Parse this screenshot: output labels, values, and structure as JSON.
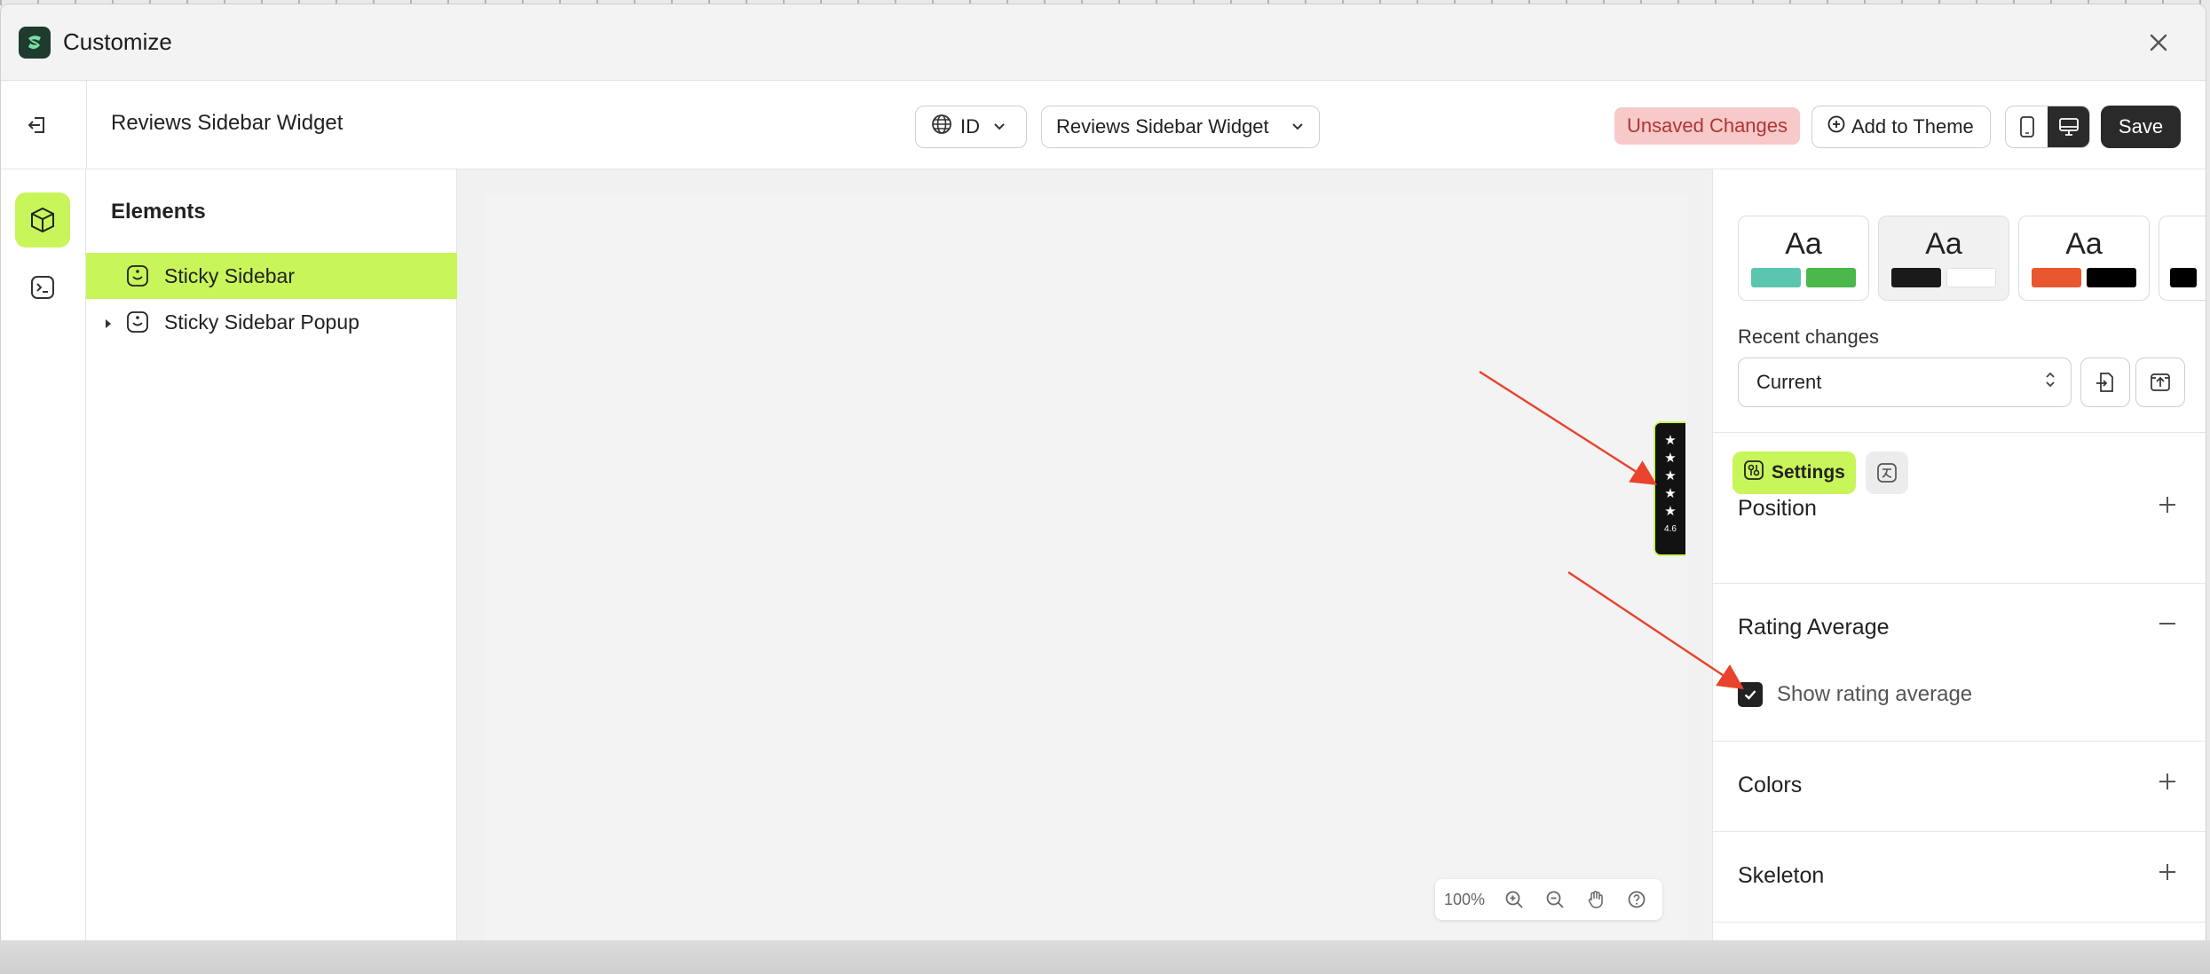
{
  "window": {
    "title": "Customize"
  },
  "toolbar": {
    "page_name": "Reviews Sidebar Widget",
    "language": "ID",
    "template": "Reviews Sidebar Widget",
    "unsaved": "Unsaved Changes",
    "add_to_theme": "Add to Theme",
    "save": "Save"
  },
  "layers": {
    "heading": "Elements",
    "items": [
      {
        "label": "Sticky Sidebar"
      },
      {
        "label": "Sticky Sidebar Popup"
      }
    ]
  },
  "canvas": {
    "widget": {
      "stars": [
        "★",
        "★",
        "★",
        "★",
        "★"
      ],
      "average": "4.6"
    },
    "zoom": "100%"
  },
  "panel": {
    "themes": [
      {
        "label": "Aa",
        "colors": [
          "#5cc5b0",
          "#4cb74a"
        ]
      },
      {
        "label": "Aa",
        "colors": [
          "#1a1a1a",
          "#ffffff"
        ]
      },
      {
        "label": "Aa",
        "colors": [
          "#e8572f",
          "#000000"
        ]
      }
    ],
    "recent_changes_label": "Recent changes",
    "recent_changes_value": "Current",
    "settings_tab": "Settings",
    "sections": {
      "position": "Position",
      "rating_average": "Rating Average",
      "show_rating_average": "Show rating average",
      "colors": "Colors",
      "skeleton": "Skeleton"
    },
    "show_rating_average_checked": true
  },
  "colors": {
    "accent": "#c8f55a",
    "annotation_arrow": "#e8432c",
    "dark": "#2a2a2a"
  }
}
